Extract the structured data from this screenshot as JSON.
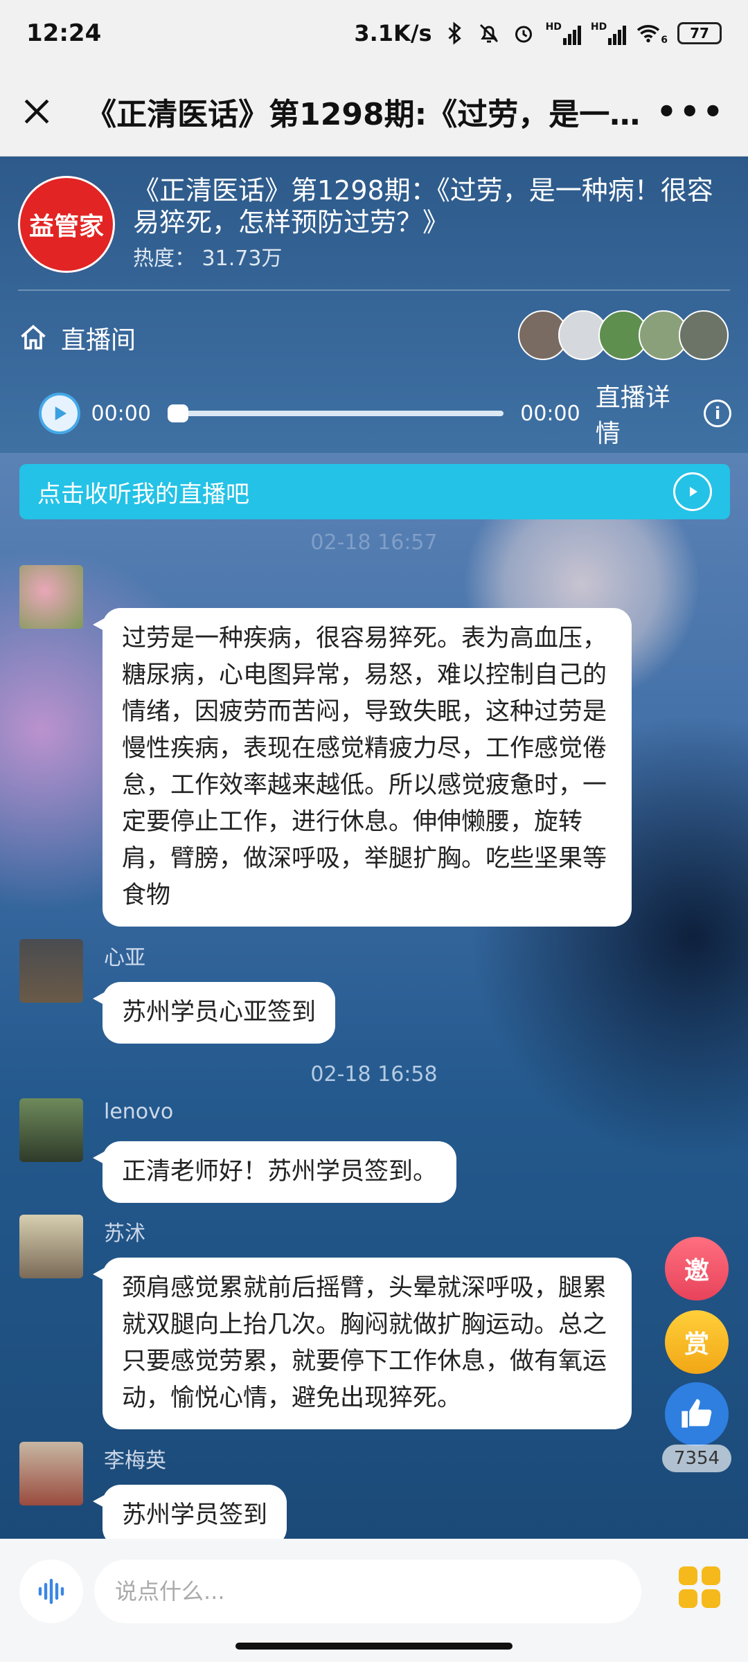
{
  "status_bar": {
    "time": "12:24",
    "net_speed": "3.1K/s",
    "signal1_label": "HD",
    "signal2_label": "HD",
    "wifi_label": "6",
    "battery": "77"
  },
  "title_bar": {
    "title": "《正清医话》第1298期:《过劳，是一种病..."
  },
  "header": {
    "logo_text": "益管家",
    "title": "《正清医话》第1298期：《过劳，是一种病！很容易猝死，怎样预防过劳？》",
    "heat": "热度： 31.73万",
    "room_label": "直播间",
    "player": {
      "current_time": "00:00",
      "total_time": "00:00",
      "progress": 0,
      "details_label": "直播详情"
    }
  },
  "chat": {
    "listen_banner": "点击收听我的直播吧",
    "timestamps": [
      "02-18 16:57",
      "02-18 16:58"
    ],
    "messages": [
      {
        "name": "",
        "text": "过劳是一种疾病，很容易猝死。表为高血压，糖尿病，心电图异常，易怒，难以控制自己的情绪，因疲劳而苦闷，导致失眠，这种过劳是慢性疾病，表现在感觉精疲力尽，工作感觉倦怠，工作效率越来越低。所以感觉疲惫时，一定要停止工作，进行休息。伸伸懒腰，旋转肩，臂膀，做深呼吸，举腿扩胸。吃些坚果等食物"
      },
      {
        "name": "心亚",
        "text": "苏州学员心亚签到"
      },
      {
        "name": "lenovo",
        "text": "正清老师好！苏州学员签到。"
      },
      {
        "name": "苏沭",
        "text": "颈肩感觉累就前后摇臂，头晕就深呼吸，腿累就双腿向上抬几次。胸闷就做扩胸运动。总之只要感觉劳累，就要停下工作休息，做有氧运动，愉悦心情，避免出现猝死。"
      },
      {
        "name": "李梅英",
        "text": "苏州学员签到"
      }
    ]
  },
  "floating": {
    "invite_label": "邀",
    "reward_label": "赏",
    "like_count": "7354"
  },
  "input": {
    "placeholder": "说点什么..."
  },
  "colors": {
    "accent_cyan": "#24c2e6",
    "logo_red": "#e22424",
    "reward_gold": "#f6b91b"
  }
}
